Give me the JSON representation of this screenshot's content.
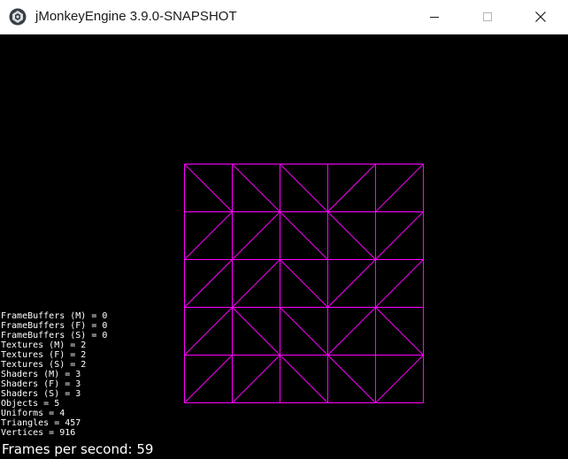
{
  "window": {
    "title": "jMonkeyEngine 3.9.0-SNAPSHOT",
    "app_icon": "jmonkeyengine-logo-icon",
    "controls": {
      "minimize_icon": "minimize-icon",
      "maximize_icon": "maximize-icon",
      "close_icon": "close-icon"
    }
  },
  "scene": {
    "background_color": "#000000",
    "wireframe_color": "#ff00ff",
    "grid": {
      "rows": 5,
      "cols": 5,
      "diagonals": [
        [
          "\\",
          "\\",
          "\\",
          "/",
          "/"
        ],
        [
          "/",
          "/",
          "\\",
          "\\",
          "/"
        ],
        [
          "/",
          "/",
          "\\",
          "/",
          "/"
        ],
        [
          "/",
          "\\",
          "\\",
          "/",
          "\\"
        ],
        [
          "/",
          "/",
          "\\",
          "\\",
          "/"
        ]
      ]
    }
  },
  "stats": [
    "FrameBuffers (M) = 0",
    "FrameBuffers (F) = 0",
    "FrameBuffers (S) = 0",
    "Textures (M) = 2",
    "Textures (F) = 2",
    "Textures (S) = 2",
    "Shaders (M) = 3",
    "Shaders (F) = 3",
    "Shaders (S) = 3",
    "Objects = 5",
    "Uniforms = 4",
    "Triangles = 457",
    "Vertices = 916"
  ],
  "fps_text": "Frames per second: 59"
}
